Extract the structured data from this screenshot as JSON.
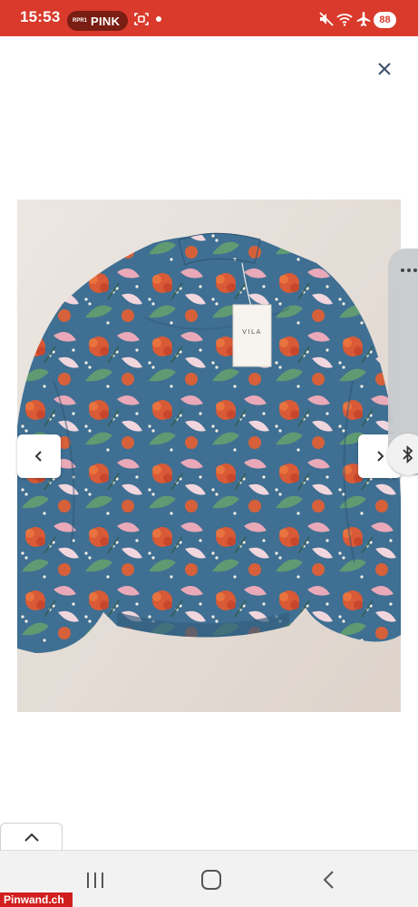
{
  "status_bar": {
    "time": "15:53",
    "radio_small": "RPR1",
    "radio_name": "PINK",
    "battery": "88",
    "color": "#d93a2b"
  },
  "viewer": {
    "close_icon": "close-icon",
    "prev_icon": "chevron-left-icon",
    "next_icon": "chevron-right-icon",
    "tag_brand": "VILA"
  },
  "edge_panel": {
    "handle_icon": "more-dots-icon",
    "bluetooth_icon": "bluetooth-icon"
  },
  "bottom": {
    "scroll_up_icon": "chevron-up-icon"
  },
  "system_nav": {
    "recent_icon": "recent-apps-icon",
    "home_icon": "home-icon",
    "back_icon": "back-icon"
  },
  "watermark": "Pinwand.ch"
}
